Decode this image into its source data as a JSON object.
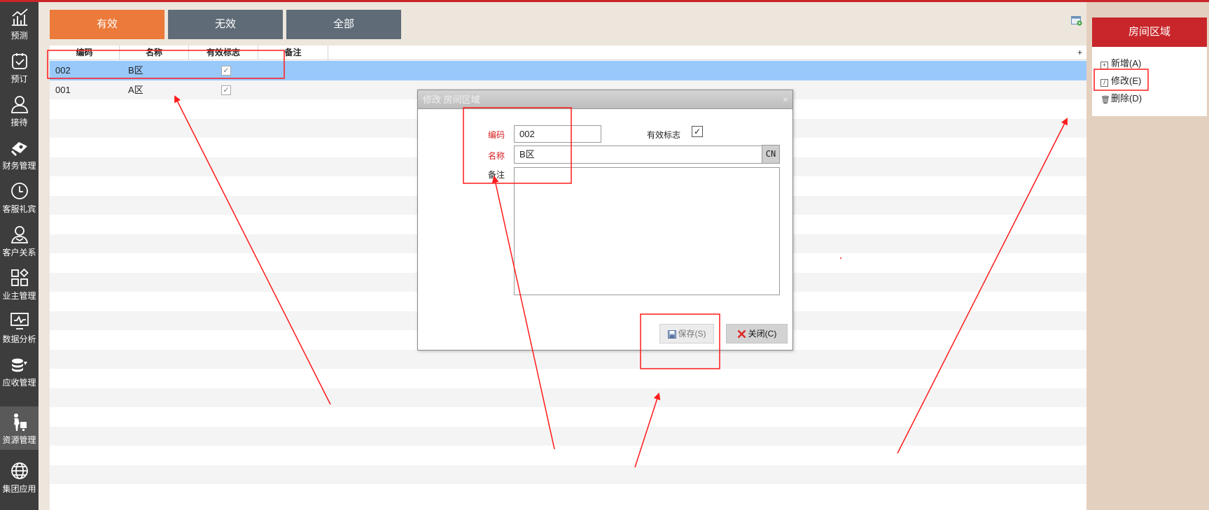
{
  "sidebar": {
    "items": [
      {
        "label": "预测",
        "icon": "forecast-chart-icon"
      },
      {
        "label": "预订",
        "icon": "booking-clipboard-icon"
      },
      {
        "label": "接待",
        "icon": "reception-person-icon"
      },
      {
        "label": "财务管理",
        "icon": "finance-money-icon"
      },
      {
        "label": "客服礼宾",
        "icon": "concierge-clock-icon"
      },
      {
        "label": "客户关系",
        "icon": "customer-relation-icon"
      },
      {
        "label": "业主管理",
        "icon": "owner-grid-icon"
      },
      {
        "label": "数据分析",
        "icon": "data-analysis-monitor-icon"
      },
      {
        "label": "应收管理",
        "icon": "receivable-coins-icon"
      },
      {
        "label": "资源管理",
        "icon": "resource-person-icon"
      },
      {
        "label": "集团应用",
        "icon": "group-globe-icon"
      }
    ],
    "active_index": 9
  },
  "filters": {
    "valid": "有效",
    "invalid": "无效",
    "all": "全部"
  },
  "grid": {
    "headers": {
      "code": "编码",
      "name": "名称",
      "valid_flag": "有效标志",
      "remark": "备注"
    },
    "plus": "+",
    "rows": [
      {
        "code": "002",
        "name": "B区",
        "valid": "✓",
        "selected": true
      },
      {
        "code": "001",
        "name": "A区",
        "valid": "✓",
        "selected": false
      }
    ]
  },
  "right_panel": {
    "title": "房间区域",
    "actions": {
      "add": "新增(A)",
      "edit": "修改(E)",
      "delete": "删除(D)"
    }
  },
  "dialog": {
    "title": "修改 房间区域",
    "close_glyph": "×",
    "code_label": "编码",
    "code_value": "002",
    "valid_label": "有效标志",
    "valid_check": "✓",
    "name_label": "名称",
    "name_value": "B区",
    "cn_label": "CN",
    "remark_label": "备注",
    "save_label": "保存(S)",
    "close_label": "关闭(C)"
  },
  "colors": {
    "accent_orange": "#ec7a3a",
    "header_red": "#c8262a",
    "selected_row": "#99c9fb",
    "annotation_red": "#ff1a1a"
  }
}
